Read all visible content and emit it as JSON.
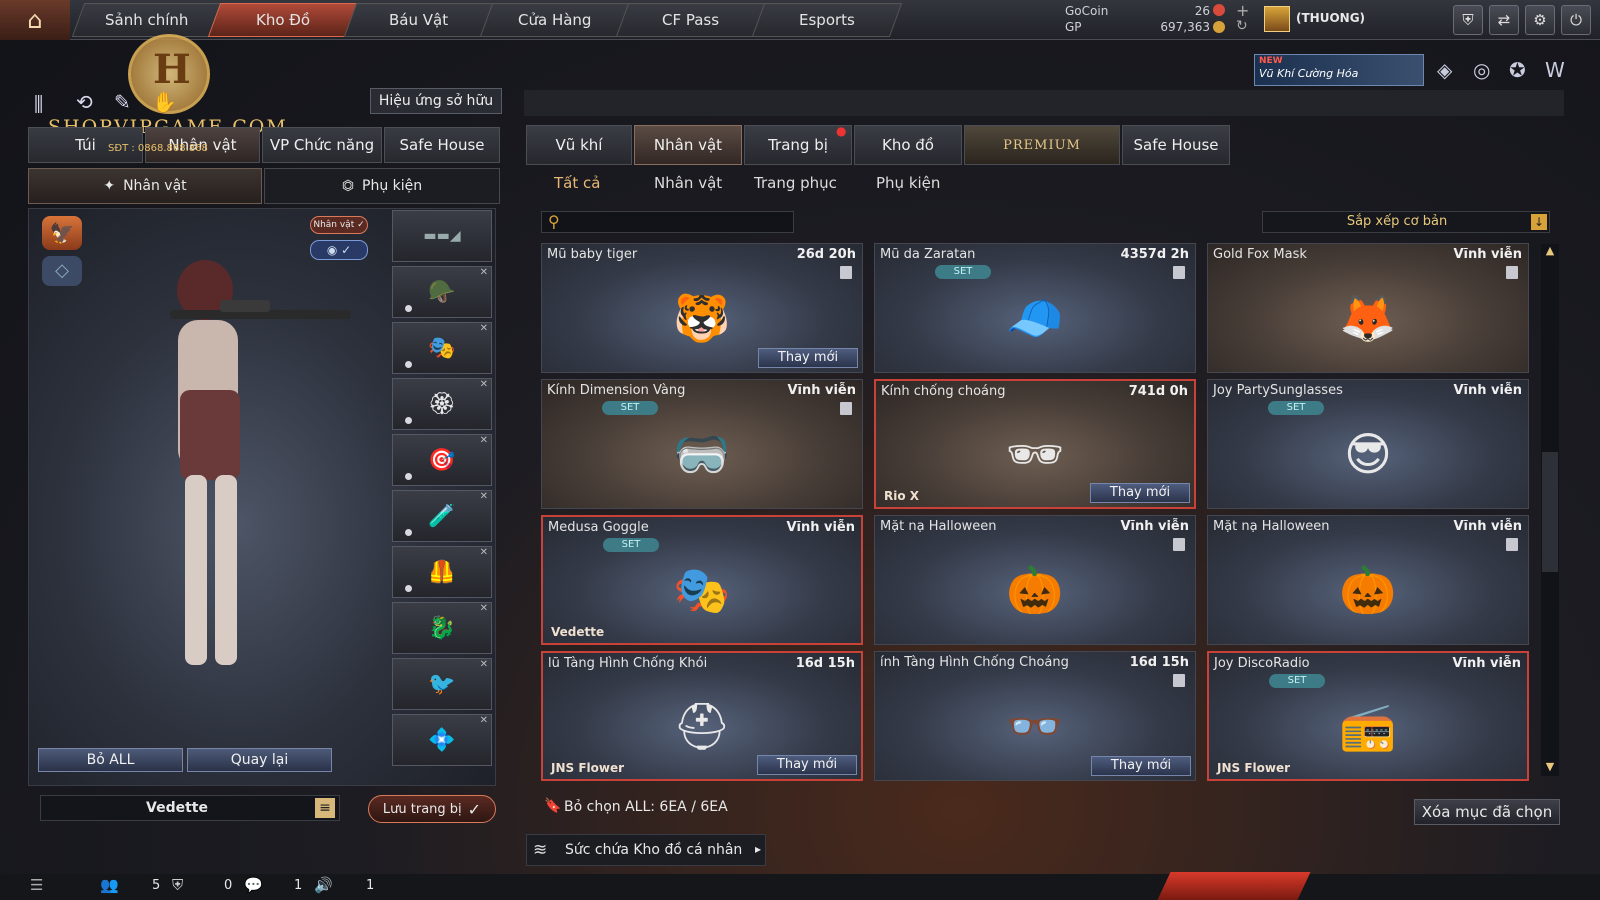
{
  "nav": {
    "tabs": [
      "Sảnh chính",
      "Kho Đồ",
      "Báu Vật",
      "Cửa Hàng",
      "CF Pass",
      "Esports"
    ],
    "active": 1
  },
  "currency": {
    "gocoin_label": "GoCoin",
    "gocoin": "26",
    "gp_label": "GP",
    "gp": "697,363"
  },
  "rank": "(THUONG)",
  "promo": {
    "badge": "NEW",
    "text": "Vũ Khí Cường Hóa"
  },
  "watermark": {
    "site": "SHOPVIPGAME.COM",
    "phone": "SĐT : 0868.868.868",
    "letter": "H"
  },
  "left": {
    "effect_btn": "Hiệu ứng sở hữu",
    "tabs": [
      "Túi",
      "Nhân vật",
      "VP Chức năng",
      "Safe House"
    ],
    "subtabs": [
      "Nhân vật",
      "Phụ kiện"
    ],
    "char_badge": "Nhân vật ✓",
    "bo_all": "Bỏ ALL",
    "quay_lai": "Quay lại",
    "char_name": "Vedette",
    "save": "Lưu trang bị"
  },
  "right": {
    "tabs": [
      "Vũ khí",
      "Nhân vật",
      "Trang bị",
      "Kho đồ",
      "PREMIUM",
      "Safe House"
    ],
    "categories": [
      "Tất cả",
      "Nhân vật",
      "Trang phục",
      "Phụ kiện"
    ],
    "search_placeholder": "",
    "sort": "Sắp xếp cơ bản",
    "items": [
      {
        "name": "Mũ baby tiger",
        "time": "26d 20h",
        "set": false,
        "owner": "",
        "replace": "Thay mới",
        "icon": "tiger-hat-icon",
        "glyph": "🐯"
      },
      {
        "name": "Mũ da Zaratan",
        "time": "4357d 2h",
        "set": true,
        "owner": "",
        "replace": "",
        "icon": "cap-icon",
        "glyph": "🧢"
      },
      {
        "name": "Gold Fox Mask",
        "time": "Vĩnh viễn",
        "set": false,
        "owner": "",
        "replace": "",
        "icon": "fox-mask-icon",
        "glyph": "🦊"
      },
      {
        "name": "Kính Dimension Vàng",
        "time": "Vĩnh viễn",
        "set": true,
        "owner": "",
        "replace": "",
        "icon": "goggles-icon",
        "glyph": "🥽"
      },
      {
        "name": "Kính chống choáng",
        "time": "741d 0h",
        "set": false,
        "owner": "Rio X",
        "replace": "Thay mới",
        "icon": "sunglasses-icon",
        "glyph": "🕶"
      },
      {
        "name": "Joy PartySunglasses",
        "time": "Vĩnh viễn",
        "set": true,
        "owner": "",
        "replace": "",
        "icon": "party-glasses-icon",
        "glyph": "😎"
      },
      {
        "name": "Medusa Goggle",
        "time": "Vĩnh viễn",
        "set": true,
        "owner": "Vedette",
        "replace": "",
        "icon": "medusa-mask-icon",
        "glyph": "🎭"
      },
      {
        "name": "Mặt nạ Halloween",
        "time": "Vĩnh viễn",
        "set": false,
        "owner": "",
        "replace": "",
        "icon": "halloween-mask-icon",
        "glyph": "🎃"
      },
      {
        "name": "Mặt nạ Halloween",
        "time": "Vĩnh viễn",
        "set": false,
        "owner": "",
        "replace": "",
        "icon": "halloween-mask-icon",
        "glyph": "🎃"
      },
      {
        "name": "lũ Tàng Hình Chống Khói",
        "time": "16d 15h",
        "set": false,
        "owner": "JNS Flower",
        "replace": "Thay mới",
        "icon": "helmet-icon",
        "glyph": "⛑"
      },
      {
        "name": "ính Tàng Hình Chống Choáng",
        "time": "16d 15h",
        "set": false,
        "owner": "",
        "replace": "Thay mới",
        "icon": "glasses-icon",
        "glyph": "👓"
      },
      {
        "name": "Joy DiscoRadio",
        "time": "Vĩnh viễn",
        "set": true,
        "owner": "JNS Flower",
        "replace": "",
        "icon": "radio-icon",
        "glyph": "📻"
      }
    ],
    "select_info": "Bỏ chọn ALL: 6EA / 6EA",
    "delete": "Xóa mục đã chọn",
    "capacity": "Sức chứa Kho đồ cá nhân"
  },
  "bottom": {
    "c1": "5",
    "c2": "0",
    "c3": "1",
    "c4": "1"
  }
}
